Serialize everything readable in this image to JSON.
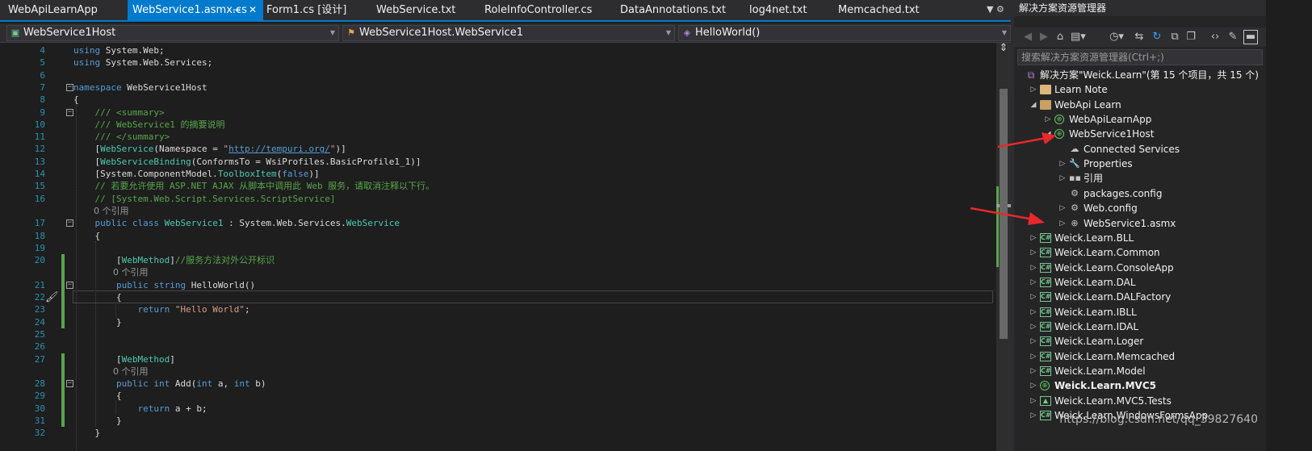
{
  "tabs": [
    {
      "label": "WebApiLearnApp",
      "active": false
    },
    {
      "label": "WebService1.asmx.cs",
      "active": true,
      "pin_icon": "pin-icon",
      "close_icon": "close-icon"
    },
    {
      "label": "Form1.cs [设计]",
      "active": false
    },
    {
      "label": "WebService.txt",
      "active": false
    },
    {
      "label": "RoleInfoController.cs",
      "active": false
    },
    {
      "label": "DataAnnotations.txt",
      "active": false
    },
    {
      "label": "log4net.txt",
      "active": false
    },
    {
      "label": "Memcached.txt",
      "active": false
    }
  ],
  "tab_menu_glyph": "▼ ⚙",
  "navbar": {
    "project": "WebService1Host",
    "type": "WebService1Host.WebService1",
    "member": "HelloWorld()"
  },
  "code_lines": [
    {
      "num": "4",
      "segs": [
        [
          "kw",
          "using"
        ],
        [
          "ident",
          " System.Web;"
        ]
      ]
    },
    {
      "num": "5",
      "segs": [
        [
          "kw",
          "using"
        ],
        [
          "ident",
          " System.Web.Services;"
        ]
      ]
    },
    {
      "num": "6",
      "segs": []
    },
    {
      "num": "7",
      "segs": [
        [
          "kw",
          "namespace"
        ],
        [
          "ident",
          " WebService1Host"
        ]
      ]
    },
    {
      "num": "8",
      "segs": [
        [
          "ident",
          "{"
        ]
      ]
    },
    {
      "num": "9",
      "segs": [
        [
          "cm",
          "    /// <summary>"
        ]
      ]
    },
    {
      "num": "10",
      "segs": [
        [
          "cm",
          "    /// WebService1 的摘要说明"
        ]
      ]
    },
    {
      "num": "11",
      "segs": [
        [
          "cm",
          "    /// </summary>"
        ]
      ]
    },
    {
      "num": "12",
      "segs": [
        [
          "ident",
          "    ["
        ],
        [
          "ty",
          "WebService"
        ],
        [
          "ident",
          "(Namespace = "
        ],
        [
          "st",
          "\""
        ],
        [
          "lk",
          "http://tempuri.org/"
        ],
        [
          "st",
          "\""
        ],
        [
          "ident",
          ")]"
        ]
      ]
    },
    {
      "num": "13",
      "segs": [
        [
          "ident",
          "    ["
        ],
        [
          "ty",
          "WebServiceBinding"
        ],
        [
          "ident",
          "(ConformsTo = WsiProfiles.BasicProfile1_1)]"
        ]
      ]
    },
    {
      "num": "14",
      "segs": [
        [
          "ident",
          "    [System.ComponentModel."
        ],
        [
          "ty",
          "ToolboxItem"
        ],
        [
          "ident",
          "("
        ],
        [
          "kw",
          "false"
        ],
        [
          "ident",
          ")]"
        ]
      ]
    },
    {
      "num": "15",
      "segs": [
        [
          "cm",
          "    // 若要允许使用 ASP.NET AJAX 从脚本中调用此 Web 服务，请取消注释以下行。"
        ]
      ]
    },
    {
      "num": "16",
      "segs": [
        [
          "cm",
          "    // [System.Web.Script.Services.ScriptService]"
        ]
      ]
    },
    {
      "lens": "0 个引用"
    },
    {
      "num": "17",
      "segs": [
        [
          "kw",
          "    public class"
        ],
        [
          "ident",
          " "
        ],
        [
          "ty",
          "WebService1"
        ],
        [
          "ident",
          " : System.Web.Services."
        ],
        [
          "ty",
          "WebService"
        ]
      ]
    },
    {
      "num": "18",
      "segs": [
        [
          "ident",
          "    {"
        ]
      ]
    },
    {
      "num": "19",
      "segs": []
    },
    {
      "num": "20",
      "segs": [
        [
          "ident",
          "        ["
        ],
        [
          "ty",
          "WebMethod"
        ],
        [
          "ident",
          "]"
        ],
        [
          "cm",
          "//服务方法对外公开标识"
        ]
      ]
    },
    {
      "lens": "0 个引用"
    },
    {
      "num": "21",
      "segs": [
        [
          "kw",
          "        public string"
        ],
        [
          "ident",
          " HelloWorld()"
        ]
      ]
    },
    {
      "num": "22",
      "segs": [
        [
          "ident",
          "        {"
        ]
      ]
    },
    {
      "num": "23",
      "segs": [
        [
          "kw",
          "            return"
        ],
        [
          "ident",
          " "
        ],
        [
          "st",
          "\"Hello World\""
        ],
        [
          "ident",
          ";"
        ]
      ]
    },
    {
      "num": "24",
      "segs": [
        [
          "ident",
          "        }"
        ]
      ]
    },
    {
      "num": "25",
      "segs": []
    },
    {
      "num": "26",
      "segs": []
    },
    {
      "num": "27",
      "segs": [
        [
          "ident",
          "        ["
        ],
        [
          "ty",
          "WebMethod"
        ],
        [
          "ident",
          "]"
        ]
      ]
    },
    {
      "lens": "0 个引用"
    },
    {
      "num": "28",
      "segs": [
        [
          "kw",
          "        public int"
        ],
        [
          "ident",
          " Add("
        ],
        [
          "kw",
          "int"
        ],
        [
          "ident",
          " a, "
        ],
        [
          "kw",
          "int"
        ],
        [
          "ident",
          " b)"
        ]
      ]
    },
    {
      "num": "29",
      "segs": [
        [
          "ident",
          "        {"
        ]
      ]
    },
    {
      "num": "30",
      "segs": [
        [
          "kw",
          "            return"
        ],
        [
          "ident",
          " a + b;"
        ]
      ]
    },
    {
      "num": "31",
      "segs": [
        [
          "ident",
          "        }"
        ]
      ]
    },
    {
      "num": "32",
      "segs": [
        [
          "ident",
          "    }"
        ]
      ]
    }
  ],
  "solution_explorer": {
    "title": "解决方案资源管理器",
    "search_placeholder": "搜索解决方案资源管理器(Ctrl+;)",
    "toolbar_icons": [
      "back-icon",
      "forward-icon",
      "home-icon",
      "switch-views-icon",
      "history-icon",
      "sync-icon",
      "refresh-icon",
      "collapse-all-icon",
      "show-all-files-icon",
      "view-code-icon",
      "properties-icon",
      "preview-icon"
    ],
    "tree": [
      {
        "label": "解决方案\"Weick.Learn\"(第 15 个项目，共 15 个)",
        "icon": "solution-icon",
        "expand": "none"
      },
      {
        "label": "Learn Note",
        "icon": "folder-icon",
        "expand": "collapsed"
      },
      {
        "label": "WebApi Learn",
        "icon": "folder-open-icon",
        "expand": "expanded"
      },
      {
        "label": "WebApiLearnApp",
        "icon": "web-project-icon",
        "expand": "collapsed"
      },
      {
        "label": "WebService1Host",
        "icon": "web-project-icon",
        "expand": "expanded"
      },
      {
        "label": "Connected Services",
        "icon": "connected-services-icon",
        "expand": "none"
      },
      {
        "label": "Properties",
        "icon": "wrench-icon",
        "expand": "collapsed"
      },
      {
        "label": "引用",
        "icon": "references-icon",
        "expand": "collapsed"
      },
      {
        "label": "packages.config",
        "icon": "config-file-icon",
        "expand": "none"
      },
      {
        "label": "Web.config",
        "icon": "config-file-icon",
        "expand": "collapsed"
      },
      {
        "label": "WebService1.asmx",
        "icon": "asmx-file-icon",
        "expand": "collapsed"
      },
      {
        "label": "Weick.Learn.BLL",
        "icon": "csharp-project-icon",
        "expand": "collapsed"
      },
      {
        "label": "Weick.Learn.Common",
        "icon": "csharp-project-icon",
        "expand": "collapsed"
      },
      {
        "label": "Weick.Learn.ConsoleApp",
        "icon": "csharp-project-icon",
        "expand": "collapsed"
      },
      {
        "label": "Weick.Learn.DAL",
        "icon": "csharp-project-icon",
        "expand": "collapsed"
      },
      {
        "label": "Weick.Learn.DALFactory",
        "icon": "csharp-project-icon",
        "expand": "collapsed"
      },
      {
        "label": "Weick.Learn.IBLL",
        "icon": "csharp-project-icon",
        "expand": "collapsed"
      },
      {
        "label": "Weick.Learn.IDAL",
        "icon": "csharp-project-icon",
        "expand": "collapsed"
      },
      {
        "label": "Weick.Learn.Loger",
        "icon": "csharp-project-icon",
        "expand": "collapsed"
      },
      {
        "label": "Weick.Learn.Memcached",
        "icon": "csharp-project-icon",
        "expand": "collapsed"
      },
      {
        "label": "Weick.Learn.Model",
        "icon": "csharp-project-icon",
        "expand": "collapsed"
      },
      {
        "label": "Weick.Learn.MVC5",
        "icon": "web-project-icon",
        "expand": "collapsed",
        "bold": true
      },
      {
        "label": "Weick.Learn.MVC5.Tests",
        "icon": "test-project-icon",
        "expand": "collapsed"
      },
      {
        "label": "Weick.Learn.WindowsFormsApp",
        "icon": "csharp-project-icon",
        "expand": "collapsed"
      }
    ]
  },
  "watermark": "https://blog.csdn.net/qq_39827640",
  "colors": {
    "accent": "#007acc",
    "keyword": "#569cd6",
    "type": "#4ec9b0",
    "comment": "#57a64a",
    "string": "#d69d85",
    "arrow": "#e8282a"
  }
}
